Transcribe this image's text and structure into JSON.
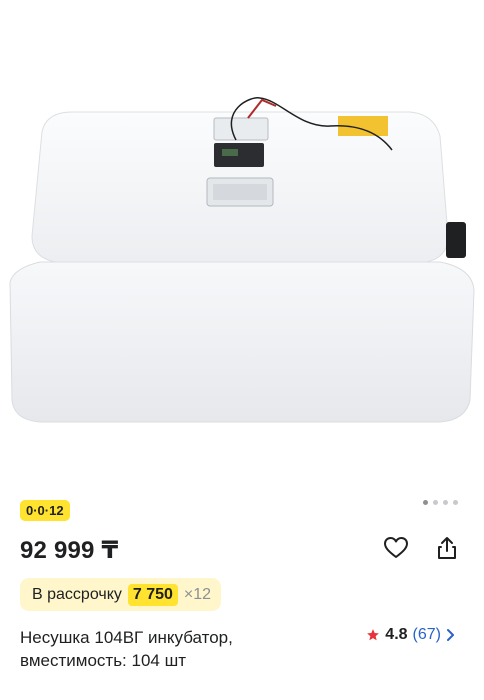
{
  "product": {
    "image_alt": "Incubator product photo",
    "installment_badge": "0·0·12",
    "price": "92 999 ₸",
    "credit": {
      "label": "В рассрочку",
      "amount": "7 750",
      "term": "×12"
    },
    "title": "Несушка 104ВГ инкубатор, вместимость: 104 шт",
    "rating": {
      "value": "4.8",
      "count": "(67)"
    }
  },
  "gallery": {
    "total_slides": 4,
    "active_slide": 1
  },
  "icons": {
    "favorite": "heart-icon",
    "share": "share-icon",
    "star": "star-icon",
    "chevron": "chevron-right-icon"
  },
  "colors": {
    "badge_yellow": "#ffe32e",
    "credit_bg": "#fff6cc",
    "star": "#e8333a",
    "link_blue": "#2a62c9"
  }
}
